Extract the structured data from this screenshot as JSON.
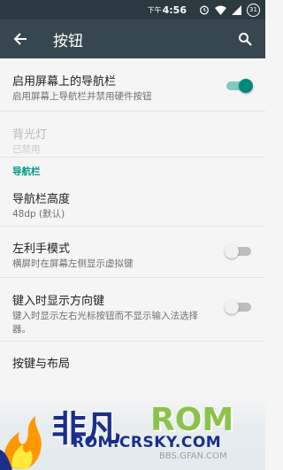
{
  "status_bar": {
    "ampm": "下午",
    "time": "4:56",
    "battery": "31"
  },
  "app_bar": {
    "title": "按钮"
  },
  "prefs": {
    "nav_bar": {
      "title": "启用屏幕上的导航栏",
      "summary": "启用屏幕上导航栏并禁用硬件按钮",
      "enabled": true
    },
    "backlight": {
      "title": "背光灯",
      "summary": "已禁用"
    },
    "category_nav": "导航栏",
    "nav_height": {
      "title": "导航栏高度",
      "summary": "48dp (默认)"
    },
    "left_hand": {
      "title": "左利手模式",
      "summary": "横屏时在屏幕左侧显示虚拟键",
      "enabled": false
    },
    "arrow_keys": {
      "title": "键入时显示方向键",
      "summary": "键入时显示左右光标按钮而不显示输入法选择器。",
      "enabled": false
    },
    "keys_layout": {
      "title": "按键与布局"
    }
  },
  "watermark": {
    "fei": "非凡",
    "rom": "ROM",
    "url": "ROM.CRSKY.COM",
    "url2": "BBS.GFAN.COM"
  }
}
